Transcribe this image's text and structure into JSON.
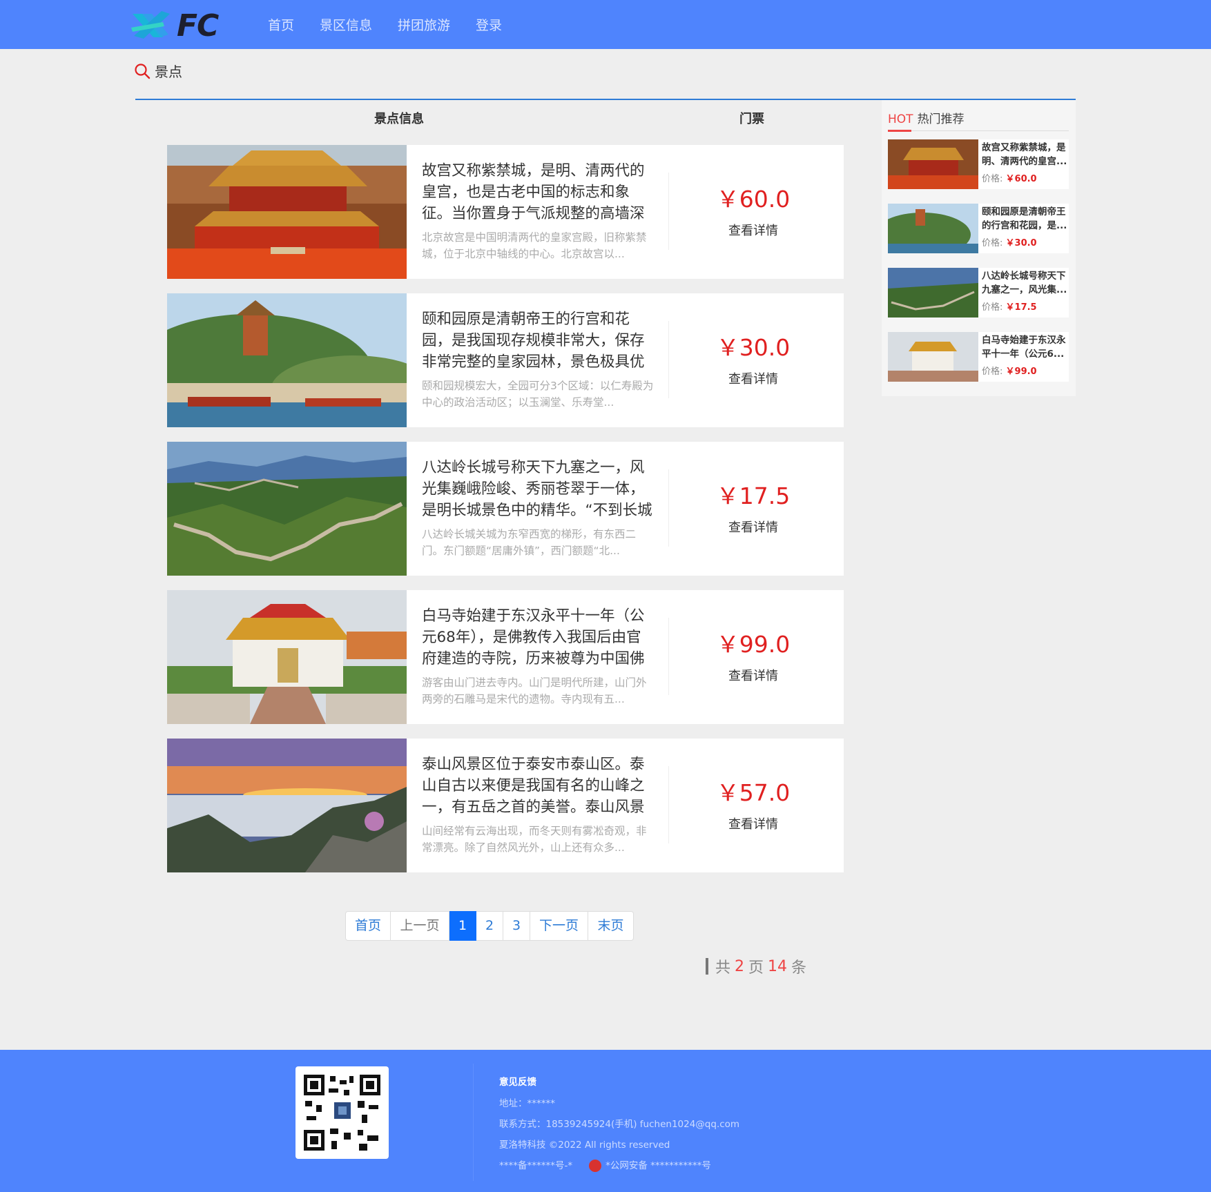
{
  "header": {
    "logo_text": "FC",
    "nav": [
      "首页",
      "景区信息",
      "拼团旅游",
      "登录"
    ]
  },
  "breadcrumb": {
    "label": "景点"
  },
  "table_head": {
    "info": "景点信息",
    "ticket": "门票"
  },
  "list": [
    {
      "title": "故宫又称紫禁城，是明、清两代的皇宫，也是古老中国的标志和象征。当你置身于气派规整的高墙深院，能...",
      "desc": "北京故宫是中国明清两代的皇家宫殿，旧称紫禁城，位于北京中轴线的中心。北京故宫以...",
      "price": "￥60.0",
      "detail": "查看详情"
    },
    {
      "title": "颐和园原是清朝帝王的行宫和花园，是我国现存规模非常大，保存非常完整的皇家园林，景色极具优雅，还...",
      "desc": "颐和园规模宏大，全园可分3个区域：以仁寿殿为中心的政治活动区；以玉澜堂、乐寿堂...",
      "price": "￥30.0",
      "detail": "查看详情"
    },
    {
      "title": "八达岭长城号称天下九塞之一，风光集巍峨险峻、秀丽苍翠于一体，是明长城景色中的精华。“不到长城非...",
      "desc": "八达岭长城关城为东窄西宽的梯形，有东西二门。东门额题“居庸外镇”，西门额题“北...",
      "price": "￥17.5",
      "detail": "查看详情"
    },
    {
      "title": "白马寺始建于东汉永平十一年（公元68年），是佛教传入我国后由官府建造的寺院，历来被尊为中国佛教...",
      "desc": "游客由山门进去寺内。山门是明代所建，山门外两旁的石雕马是宋代的遗物。寺内现有五...",
      "price": "￥99.0",
      "detail": "查看详情"
    },
    {
      "title": "泰山风景区位于泰安市泰山区。泰山自古以来便是我国有名的山峰之一，有五岳之首的美誉。泰山风景区以...",
      "desc": "山间经常有云海出现，而冬天则有雾凇奇观，非常漂亮。除了自然风光外，山上还有众多...",
      "price": "￥57.0",
      "detail": "查看详情"
    }
  ],
  "hot": {
    "tag": "HOT",
    "title": "热门推荐",
    "price_label": "价格:",
    "items": [
      {
        "text": "故宫又称紫禁城，是明、清两代的皇宫...",
        "price": "￥60.0"
      },
      {
        "text": "颐和园原是清朝帝王的行宫和花园，是...",
        "price": "￥30.0"
      },
      {
        "text": "八达岭长城号称天下九塞之一，风光集...",
        "price": "￥17.5"
      },
      {
        "text": "白马寺始建于东汉永平十一年（公元6...",
        "price": "￥99.0"
      }
    ]
  },
  "pagination": {
    "first": "首页",
    "prev": "上一页",
    "pages": [
      "1",
      "2",
      "3"
    ],
    "current": "1",
    "next": "下一页",
    "last": "末页",
    "total_prefix": "共",
    "total_pages": "2",
    "pages_unit": "页",
    "total_items": "14",
    "items_unit": "条"
  },
  "footer": {
    "feedback": "意见反馈",
    "address": "地址：******",
    "contact": "联系方式：18539245924(手机)    fuchen1024@qq.com",
    "copyright": "夏洛特科技 ©2022 All rights reserved",
    "icp": "****备******号-*",
    "police": "*公网安备 ***********号"
  },
  "colors": {
    "header_bg": "#4f84fd",
    "accent": "#2d7bd6",
    "price": "#e02020",
    "hot": "#e44444"
  }
}
